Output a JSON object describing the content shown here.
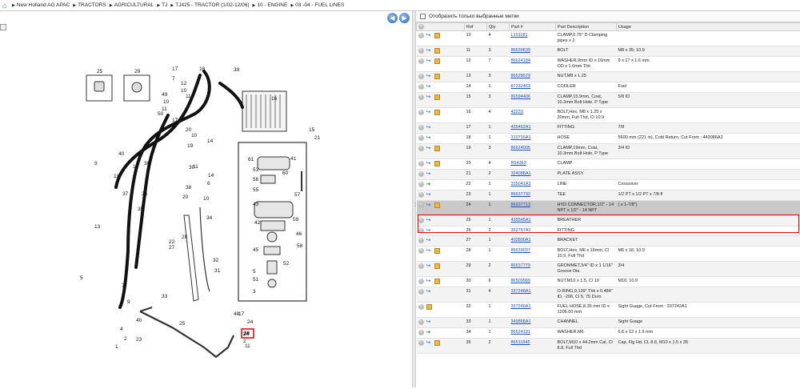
{
  "breadcrumb": [
    "New Holland AG APAC",
    "TRACTORS",
    "AGRICULTURAL",
    "TJ",
    "TJ425 - TRACTOR (1/02-12/06)",
    "10 - ENGINE",
    "03 -04 - FUEL LINES"
  ],
  "filter": {
    "label": "Отобразить только выбранные метки"
  },
  "table": {
    "headers": [
      "Ref",
      "Qty",
      "Part #",
      "Part Description",
      "Usage"
    ],
    "rows": [
      {
        "ref": "10",
        "qty": "4",
        "part": "L101181",
        "desc": "CLAMP,0.75\" D Clamping pipes x 2",
        "usage": "",
        "icons": [
          "plus",
          "blue",
          "box"
        ]
      },
      {
        "ref": "11",
        "qty": "3",
        "part": "86639639",
        "desc": "BOLT",
        "usage": "M8 x 35; 10.9",
        "icons": [
          "plus",
          "blue",
          "box"
        ]
      },
      {
        "ref": "12",
        "qty": "7",
        "part": "86624184",
        "desc": "WASHER,9mm ID x 16mm OD x 1.6mm Thk",
        "usage": "9 x 17 x 1.6 mm",
        "icons": [
          "plus",
          "blue",
          "box"
        ]
      },
      {
        "ref": "13",
        "qty": "3",
        "part": "86528579",
        "desc": "NUT,M8 x 1.25",
        "usage": "",
        "icons": [
          "plus",
          "blue",
          "box"
        ]
      },
      {
        "ref": "14",
        "qty": "1",
        "part": "87332463",
        "desc": "COOLER",
        "usage": "Fuel",
        "icons": [
          "plus",
          "blue"
        ]
      },
      {
        "ref": "15",
        "qty": "3",
        "part": "86594406",
        "desc": "CLAMP,15.9mm, Coat, 10.3mm Bolt Hole, P Type",
        "usage": "5/8 ID",
        "icons": [
          "plus",
          "blue",
          "box"
        ]
      },
      {
        "ref": "16",
        "qty": "4",
        "part": "43233",
        "desc": "BOLT,Hex, M8 x 1.25 x 20mm, Full Thd, Cl 10.9",
        "usage": "",
        "icons": [
          "plus",
          "blue",
          "box"
        ]
      },
      {
        "ref": "17",
        "qty": "1",
        "part": "435462A1",
        "desc": "FITTING",
        "usage": "7/8",
        "icons": [
          "plus",
          "blue"
        ]
      },
      {
        "ref": "18",
        "qty": "1",
        "part": "310715A1",
        "desc": "HOSE",
        "usage": "5600 mm (221 in), Cold Return, Cut From : 443086A1",
        "icons": [
          "plus",
          "blue"
        ]
      },
      {
        "ref": "19",
        "qty": "3",
        "part": "86624005",
        "desc": "CLAMP,19mm, Coat, 10.3mm Bolt Hole, P Type",
        "usage": "3/4 ID",
        "icons": [
          "plus",
          "blue",
          "box"
        ]
      },
      {
        "ref": "20",
        "qty": "4",
        "part": "R54363",
        "desc": "CLAMP",
        "usage": "",
        "icons": [
          "plus",
          "blue",
          "box"
        ]
      },
      {
        "ref": "21",
        "qty": "2",
        "part": "324088A1",
        "desc": "PLATE ASSY.",
        "usage": "",
        "icons": [
          "plus",
          "blue"
        ]
      },
      {
        "ref": "22",
        "qty": "1",
        "part": "335041A2",
        "desc": "LINE",
        "usage": "Crossover",
        "icons": [
          "plus",
          "green"
        ]
      },
      {
        "ref": "23",
        "qty": "1",
        "part": "86637792",
        "desc": "TEE",
        "usage": "1/2 PT x 1/2 PT x 7/8 fl",
        "icons": [
          "plus",
          "blue"
        ]
      },
      {
        "ref": "24",
        "qty": "1",
        "part": "86637713",
        "desc": "HYD CONNECTOR,1/2\" - 14 NPT x 1/2\" - 14 NPT",
        "usage": "( x 1-7/8\")",
        "icons": [
          "plus",
          "blue",
          "box"
        ],
        "selected": true
      },
      {
        "ref": "25",
        "qty": "1",
        "part": "435545A1",
        "desc": "BREATHER",
        "usage": "",
        "icons": [
          "plus",
          "blue"
        ]
      },
      {
        "ref": "26",
        "qty": "2",
        "part": "352767A1",
        "desc": "FITTING",
        "usage": "",
        "icons": [
          "plus",
          "blue"
        ]
      },
      {
        "ref": "27",
        "qty": "1",
        "part": "402800A1",
        "desc": "BRACKET",
        "usage": "",
        "icons": [
          "plus",
          "blue"
        ]
      },
      {
        "ref": "28",
        "qty": "1",
        "part": "86639037",
        "desc": "BOLT,Hex, M6 x 16mm, Cl 10.9, Full Thd",
        "usage": "M6 x 16; 10.9",
        "icons": [
          "plus",
          "blue",
          "box"
        ]
      },
      {
        "ref": "29",
        "qty": "2",
        "part": "86637779",
        "desc": "GROMMET,3/4\" ID x 1 1/16\" Groove Dia",
        "usage": "3/4",
        "icons": [
          "plus",
          "blue",
          "box"
        ]
      },
      {
        "ref": "30",
        "qty": "6",
        "part": "86509989",
        "desc": "NUT,M10 x 1.5, Cl 10",
        "usage": "M10; 10.9",
        "icons": [
          "plus",
          "blue",
          "box"
        ]
      },
      {
        "ref": "31",
        "qty": "4",
        "part": "337248A1",
        "desc": "O-RING,0.139\" Thk x 0.484\" ID, -206, Cl 5, 75 Duro",
        "usage": "",
        "icons": [
          "plus",
          "blue"
        ]
      },
      {
        "ref": "32",
        "qty": "1",
        "part": "337240A1",
        "desc": "FUEL HOSE,8.35 mm ID x 1206.00 mm",
        "usage": "Sight Guage, Cut From : 337242A1",
        "icons": [
          "plus",
          "box"
        ]
      },
      {
        "ref": "33",
        "qty": "1",
        "part": "349868A1",
        "desc": "CHANNEL",
        "usage": "Sight Guage",
        "icons": [
          "plus",
          "blue"
        ]
      },
      {
        "ref": "34",
        "qty": "1",
        "part": "86624181",
        "desc": "WASHER,M6",
        "usage": "6.6 x 12 x 1.6 mm",
        "icons": [
          "plus",
          "green"
        ]
      },
      {
        "ref": "35",
        "qty": "2",
        "part": "86511845",
        "desc": "BOLT,M10 x 44.2mm Cal, Cl 8.8, Full Thd",
        "usage": "Cap, Flg Hd, CL 8.8, M10 x 1.5 x 35",
        "icons": [
          "plus",
          "blue",
          "box"
        ]
      }
    ]
  },
  "diagram": {
    "callouts": [
      "25",
      "29",
      "18",
      "39",
      "17",
      "49",
      "10",
      "11",
      "50",
      "7",
      "12",
      "10",
      "11",
      "17",
      "9",
      "20",
      "10",
      "19",
      "14",
      "16",
      "15",
      "21",
      "9",
      "40",
      "30",
      "11",
      "19",
      "37",
      "36",
      "35",
      "38",
      "20",
      "14",
      "6",
      "10",
      "11",
      "34",
      "31",
      "30",
      "32",
      "28",
      "27",
      "13",
      "5",
      "7",
      "61",
      "41",
      "53",
      "60",
      "56",
      "55",
      "57",
      "43",
      "59",
      "42",
      "45",
      "46",
      "58",
      "5",
      "52",
      "51",
      "3",
      "33",
      "22",
      "25",
      "9",
      "40",
      "4",
      "2",
      "1",
      "23",
      "24",
      "26",
      "2",
      "11",
      "17",
      "48"
    ],
    "highlight": "24"
  }
}
